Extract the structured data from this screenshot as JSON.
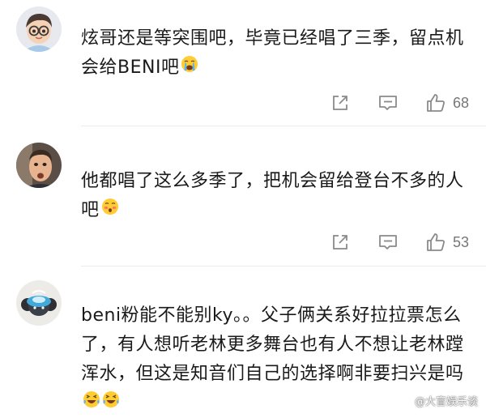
{
  "comments": [
    {
      "text": "炫哥还是等突围吧，毕竟已经唱了三季，留点机会给BENI吧",
      "emoji": "crying-face-emoji",
      "likes": "68"
    },
    {
      "text": "他都唱了这么多季了，把机会留给登台不多的人吧",
      "emoji": "hot-face-emoji",
      "likes": "53"
    },
    {
      "text": "beni粉能不能别ky。。父子俩关系好拉拉票怎么了，有人想听老林更多舞台也有人不想让老林蹚浑水，但这是知音们自己的选择啊非要扫兴是吗",
      "emoji": "laughing-crying-emoji"
    }
  ],
  "watermark": "@大盲娱乐谈",
  "colors": {
    "icon": "#8a8a8a",
    "text": "#1a1a1a",
    "divider": "#ececec"
  }
}
